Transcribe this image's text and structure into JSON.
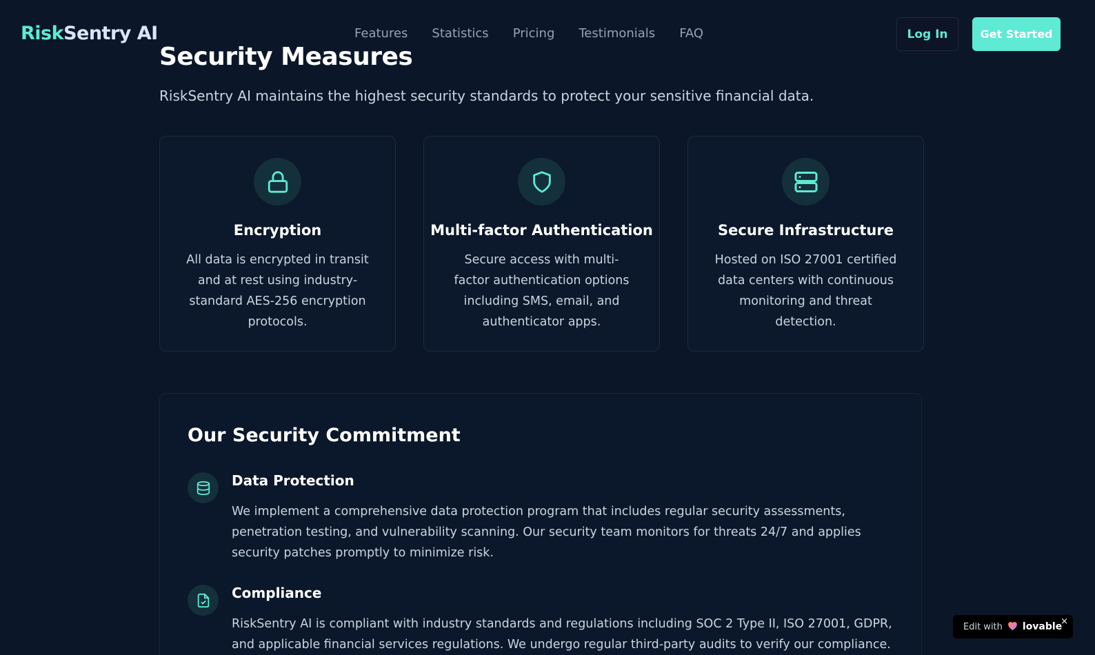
{
  "header": {
    "brand_accent": "Risk",
    "brand_rest": "Sentry AI",
    "nav": [
      "Features",
      "Statistics",
      "Pricing",
      "Testimonials",
      "FAQ"
    ],
    "login_label": "Log In",
    "cta_label": "Get Started"
  },
  "section": {
    "title": "Security Measures",
    "subtitle": "RiskSentry AI maintains the highest security standards to protect your sensitive financial data.",
    "cards": [
      {
        "icon": "lock-icon",
        "title": "Encryption",
        "desc": "All data is encrypted in transit and at rest using industry-standard AES-256 encryption protocols."
      },
      {
        "icon": "shield-icon",
        "title": "Multi-factor Authentication",
        "desc": "Secure access with multi-factor authentication options including SMS, email, and authenticator apps."
      },
      {
        "icon": "server-icon",
        "title": "Secure Infrastructure",
        "desc": "Hosted on ISO 27001 certified data centers with continuous monitoring and threat detection."
      }
    ]
  },
  "commitment": {
    "title": "Our Security Commitment",
    "items": [
      {
        "icon": "database-icon",
        "title": "Data Protection",
        "desc": "We implement a comprehensive data protection program that includes regular security assessments, penetration testing, and vulnerability scanning. Our security team monitors for threats 24/7 and applies security patches promptly to minimize risk."
      },
      {
        "icon": "file-check-icon",
        "title": "Compliance",
        "desc": "RiskSentry AI is compliant with industry standards and regulations including SOC 2 Type II, ISO 27001, GDPR, and applicable financial services regulations. We undergo regular third-party audits to verify our compliance."
      }
    ]
  },
  "badge": {
    "edit_label": "Edit with",
    "brand": "lovable",
    "close": "×"
  },
  "colors": {
    "background": "#0b1729",
    "accent": "#5eead4",
    "muted_text": "#cbd5e1",
    "nav_text": "#94a3b8"
  }
}
